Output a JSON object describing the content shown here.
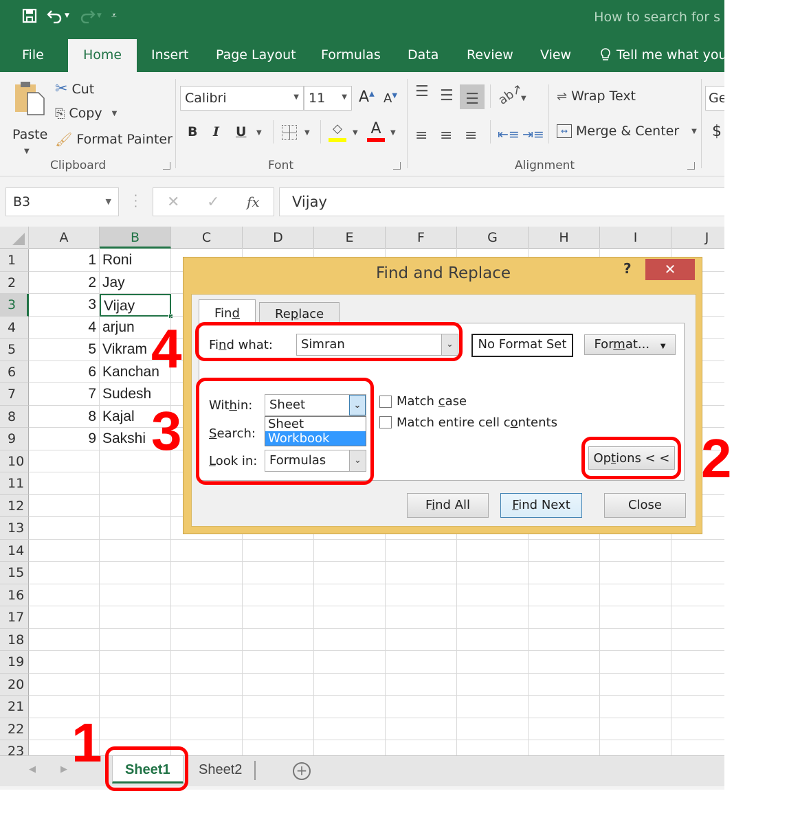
{
  "window": {
    "doc_title": "How to search for s",
    "qat": {
      "save": "save-icon",
      "undo": "undo-icon",
      "redo": "redo-icon",
      "customize": "customize-icon"
    }
  },
  "ribbon_tabs": [
    {
      "label": "File",
      "active": false
    },
    {
      "label": "Home",
      "active": true
    },
    {
      "label": "Insert",
      "active": false
    },
    {
      "label": "Page Layout",
      "active": false
    },
    {
      "label": "Formulas",
      "active": false
    },
    {
      "label": "Data",
      "active": false
    },
    {
      "label": "Review",
      "active": false
    },
    {
      "label": "View",
      "active": false
    }
  ],
  "tell_me": "Tell me what you",
  "clipboard": {
    "label": "Clipboard",
    "paste": "Paste",
    "cut": "Cut",
    "copy": "Copy",
    "format_painter": "Format Painter"
  },
  "font": {
    "label": "Font",
    "font_name": "Calibri",
    "font_size": "11",
    "bold": "B",
    "italic": "I",
    "underline": "U",
    "highlight_color": "#ffff00",
    "font_color": "#ff0000"
  },
  "alignment": {
    "label": "Alignment",
    "wrap_text": "Wrap Text",
    "merge_center": "Merge & Center"
  },
  "number": {
    "format_partial": "Ge",
    "currency": "$"
  },
  "formula_bar": {
    "name_box": "B3",
    "cancel": "✕",
    "enter": "✓",
    "fx": "fx",
    "value": "Vijay"
  },
  "columns": [
    "A",
    "B",
    "C",
    "D",
    "E",
    "F",
    "G",
    "H",
    "I",
    "J"
  ],
  "selected_column": "B",
  "selected_row": 3,
  "rows": [
    "1",
    "2",
    "3",
    "4",
    "5",
    "6",
    "7",
    "8",
    "9",
    "10",
    "11",
    "12",
    "13",
    "14",
    "15",
    "16",
    "17",
    "18",
    "19",
    "20",
    "21",
    "22",
    "23"
  ],
  "cells": [
    {
      "a": "1",
      "b": "Roni"
    },
    {
      "a": "2",
      "b": "Jay"
    },
    {
      "a": "3",
      "b": "Vijay"
    },
    {
      "a": "4",
      "b": "arjun"
    },
    {
      "a": "5",
      "b": "Vikram"
    },
    {
      "a": "6",
      "b": "Kanchan"
    },
    {
      "a": "7",
      "b": "Sudesh"
    },
    {
      "a": "8",
      "b": "Kajal"
    },
    {
      "a": "9",
      "b": "Sakshi"
    }
  ],
  "sheets": [
    {
      "label": "Sheet1",
      "active": true
    },
    {
      "label": "Sheet2",
      "active": false
    }
  ],
  "dialog": {
    "title": "Find and Replace",
    "help": "?",
    "close": "✕",
    "tabs": {
      "find": {
        "pre": "Fin",
        "ul": "d",
        "post": ""
      },
      "replace": {
        "pre": "Re",
        "ul": "p",
        "post": "lace"
      }
    },
    "find_what": {
      "pre": "Fi",
      "ul": "n",
      "post": "d what:",
      "value": "Simran"
    },
    "no_format": "No Format Set",
    "format_btn": {
      "pre": "For",
      "ul": "m",
      "post": "at..."
    },
    "within": {
      "pre": "Wit",
      "ul": "h",
      "post": "in:",
      "value": "Sheet",
      "options": [
        "Sheet",
        "Workbook"
      ],
      "highlighted": "Workbook"
    },
    "search": {
      "pre": "",
      "ul": "S",
      "post": "earch:"
    },
    "look_in": {
      "pre": "",
      "ul": "L",
      "post": "ook in:",
      "value": "Formulas"
    },
    "match_case": {
      "pre": "Match ",
      "ul": "c",
      "post": "ase",
      "checked": false
    },
    "match_entire": {
      "pre": "Match entire cell c",
      "ul": "o",
      "post": "ntents",
      "checked": false
    },
    "options_btn": {
      "pre": "Op",
      "ul": "t",
      "post": "ions < <"
    },
    "find_all": {
      "pre": "F",
      "ul": "i",
      "post": "nd All"
    },
    "find_next": {
      "pre": "",
      "ul": "F",
      "post": "ind Next"
    },
    "close_btn": "Close"
  },
  "annotations": [
    "1",
    "2",
    "3",
    "4"
  ],
  "colors": {
    "excel_green": "#217346",
    "dialog_frame": "#efc96d",
    "annotation_red": "#ff0000",
    "close_red": "#c7504c"
  }
}
